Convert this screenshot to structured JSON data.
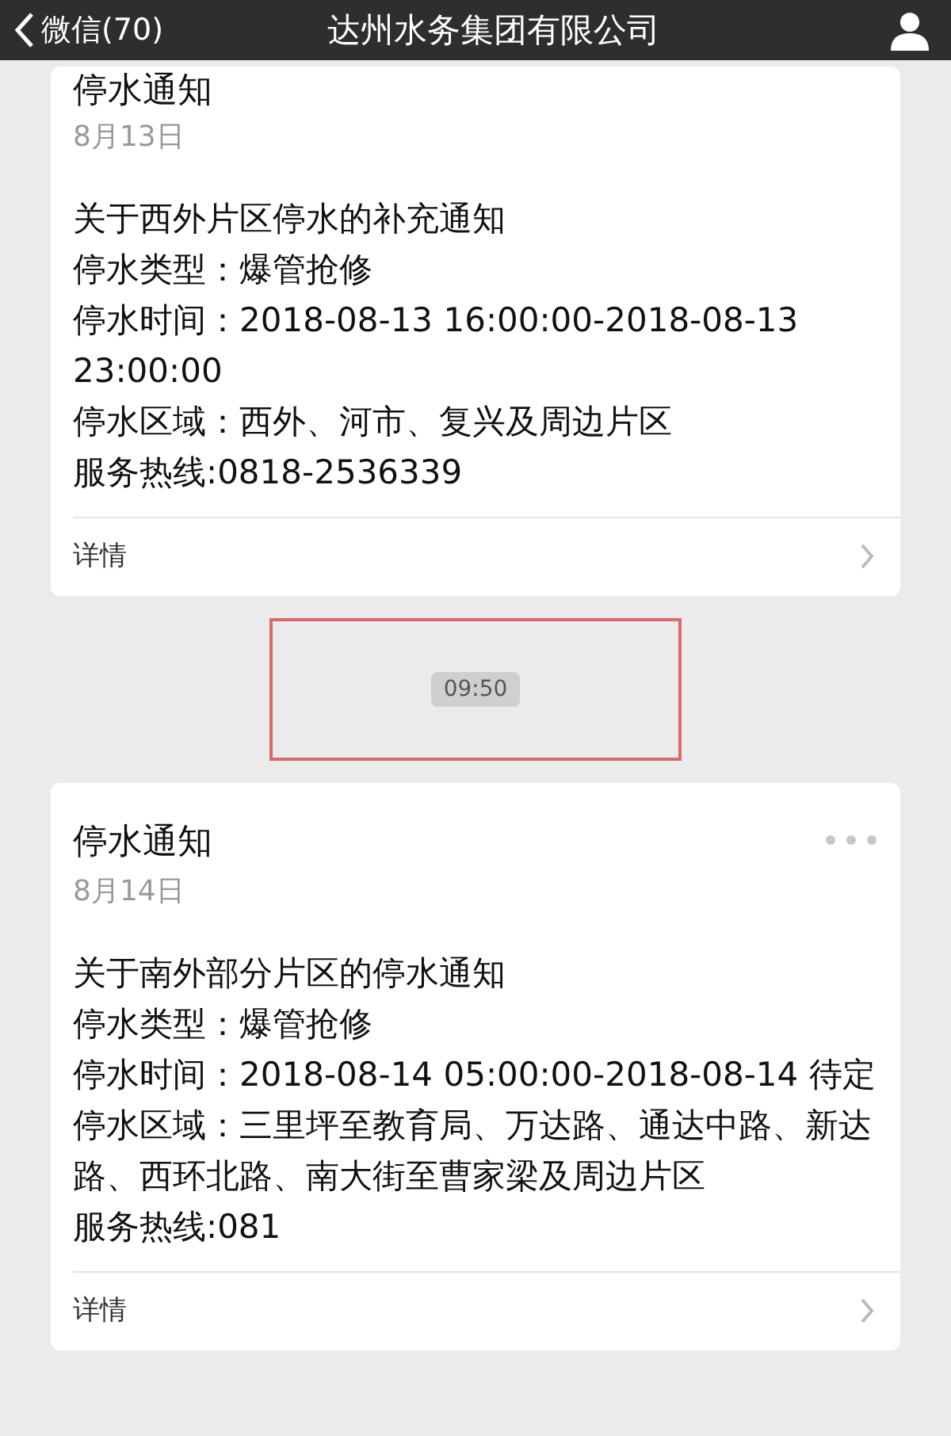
{
  "nav_bar": {
    "back_label": "微信(70)",
    "title": "达州水务集团有限公司"
  },
  "messages": [
    {
      "kind": "card",
      "title": "停水通知",
      "date": "8月13日",
      "lines": [
        "关于西外片区停水的补充通知",
        "停水类型：爆管抢修",
        "停水时间：2018-08-13 16:00:00-2018-08-13 23:00:00",
        "停水区域：西外、河市、复兴及周边片区",
        "服务热线:0818-2536339"
      ],
      "detail_label": "详情"
    },
    {
      "kind": "time",
      "time": "09:50"
    },
    {
      "kind": "card",
      "title": "停水通知",
      "date": "8月14日",
      "lines": [
        "关于南外部分片区的停水通知",
        "停水类型：爆管抢修",
        "停水时间：2018-08-14 05:00:00-2018-08-14 待定",
        "停水区域：三里坪至教育局、万达路、通达中路、新达路、西环北路、南大街至曹家梁及周边片区",
        "服务热线:081"
      ],
      "detail_label": "详情"
    }
  ]
}
